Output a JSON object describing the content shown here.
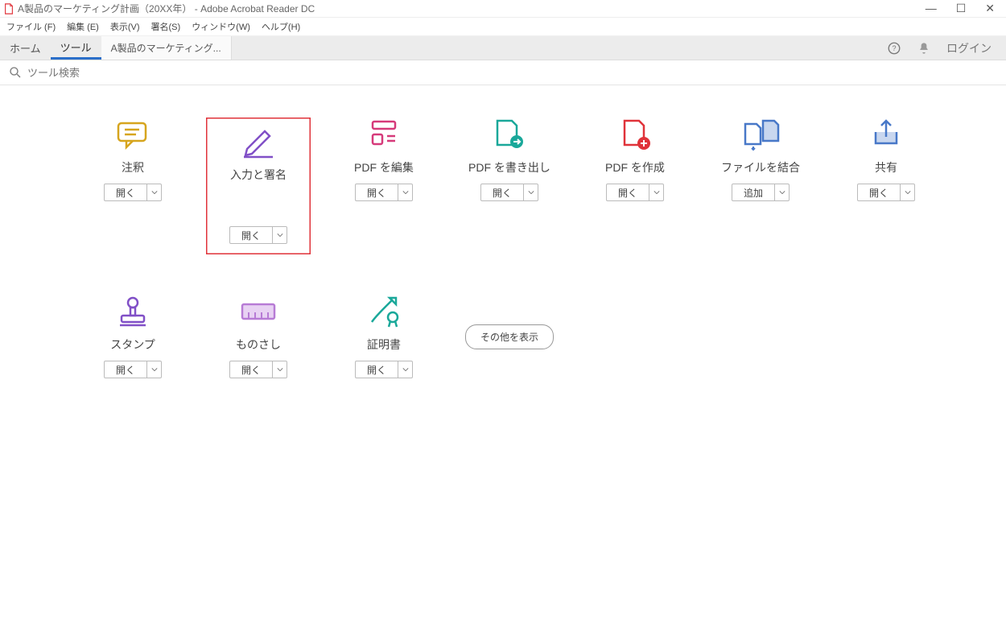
{
  "window": {
    "title": "A製品のマーケティング計画（20XX年） - Adobe Acrobat Reader DC"
  },
  "menubar": {
    "file": "ファイル (F)",
    "edit": "編集 (E)",
    "view": "表示(V)",
    "sign": "署名(S)",
    "window": "ウィンドウ(W)",
    "help": "ヘルプ(H)"
  },
  "tabs": {
    "home": "ホーム",
    "tools": "ツール",
    "doc": "A製品のマーケティング..."
  },
  "topright": {
    "login": "ログイン"
  },
  "search": {
    "placeholder": "ツール検索"
  },
  "tools": [
    {
      "id": "comment",
      "label": "注釈",
      "action": "開く"
    },
    {
      "id": "fill-sign",
      "label": "入力と署名",
      "action": "開く",
      "highlighted": true
    },
    {
      "id": "edit-pdf",
      "label": "PDF を編集",
      "action": "開く"
    },
    {
      "id": "export-pdf",
      "label": "PDF を書き出し",
      "action": "開く"
    },
    {
      "id": "create-pdf",
      "label": "PDF を作成",
      "action": "開く"
    },
    {
      "id": "combine",
      "label": "ファイルを結合",
      "action": "追加"
    },
    {
      "id": "share",
      "label": "共有",
      "action": "開く"
    },
    {
      "id": "stamp",
      "label": "スタンプ",
      "action": "開く"
    },
    {
      "id": "measure",
      "label": "ものさし",
      "action": "開く"
    },
    {
      "id": "certificate",
      "label": "証明書",
      "action": "開く"
    }
  ],
  "show_more": "その他を表示",
  "icon_colors": {
    "comment": "#d6a51e",
    "fill_sign": "#8150c7",
    "edit_pdf": "#d63a7a",
    "export_pdf": "#1aa89a",
    "create_pdf": "#e0333a",
    "combine": "#4878c8",
    "share": "#4878c8",
    "stamp": "#8150c7",
    "measure": "#b77bd5",
    "certificate": "#1aa89a"
  }
}
